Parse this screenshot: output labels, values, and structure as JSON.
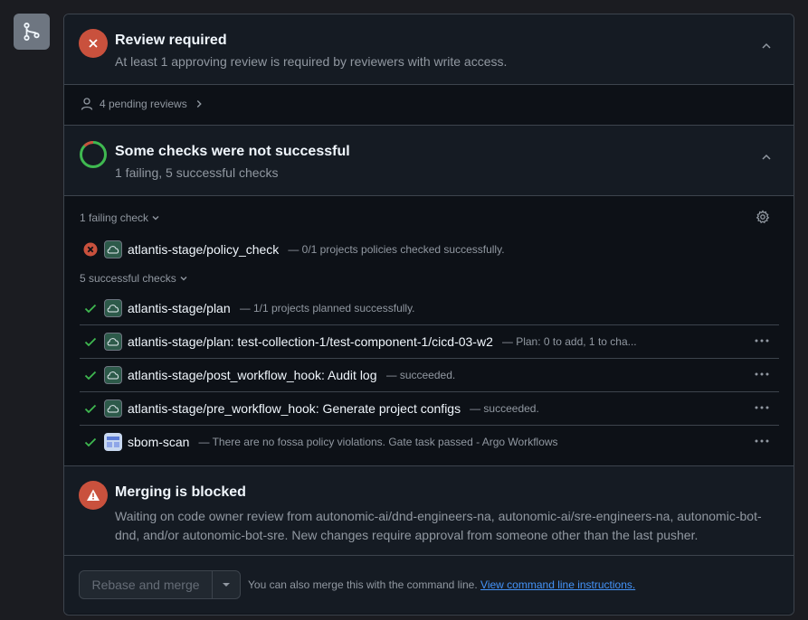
{
  "review": {
    "title": "Review required",
    "subtitle": "At least 1 approving review is required by reviewers with write access."
  },
  "pending": {
    "label": "4 pending reviews"
  },
  "checks": {
    "title": "Some checks were not successful",
    "subtitle": "1 failing, 5 successful checks",
    "failing_label": "1 failing check",
    "successful_label": "5 successful checks",
    "failing": [
      {
        "name": "atlantis-stage/policy_check",
        "desc": "— 0/1 projects policies checked successfully."
      }
    ],
    "successful": [
      {
        "name": "atlantis-stage/plan",
        "desc": "— 1/1 projects planned successfully."
      },
      {
        "name": "atlantis-stage/plan: test-collection-1/test-component-1/cicd-03-w2",
        "desc": "— Plan: 0 to add, 1 to cha..."
      },
      {
        "name": "atlantis-stage/post_workflow_hook: Audit log",
        "desc": "— succeeded."
      },
      {
        "name": "atlantis-stage/pre_workflow_hook: Generate project configs",
        "desc": "— succeeded."
      },
      {
        "name": "sbom-scan",
        "desc": "— There are no fossa policy violations. Gate task passed - Argo Workflows"
      }
    ]
  },
  "blocked": {
    "title": "Merging is blocked",
    "text": "Waiting on code owner review from autonomic-ai/dnd-engineers-na, autonomic-ai/sre-engineers-na, autonomic-bot-dnd, and/or autonomic-bot-sre. New changes require approval from someone other than the last pusher."
  },
  "action": {
    "button_label": "Rebase and merge",
    "note": "You can also merge this with the command line.",
    "link": "View command line instructions."
  },
  "colors": {
    "fail": "#c9513d",
    "success": "#3fb950",
    "link": "#4493f8"
  }
}
